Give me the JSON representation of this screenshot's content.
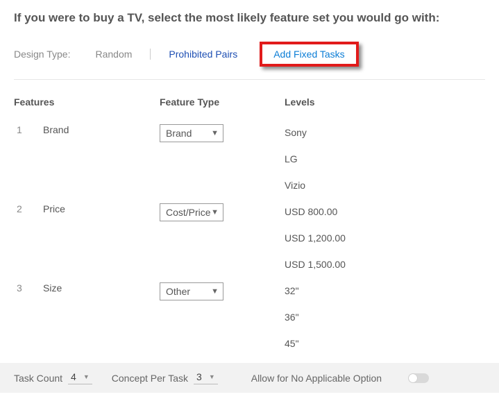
{
  "prompt": "If you were to buy a TV, select the most likely feature set you would go with:",
  "toolbar": {
    "design_type_label": "Design Type:",
    "design_type_value": "Random",
    "prohibited_pairs": "Prohibited Pairs",
    "add_fixed_tasks": "Add Fixed Tasks"
  },
  "headers": {
    "features": "Features",
    "feature_type": "Feature Type",
    "levels": "Levels"
  },
  "features": [
    {
      "idx": "1",
      "name": "Brand",
      "type": "Brand",
      "levels": [
        "Sony",
        "LG",
        "Vizio"
      ]
    },
    {
      "idx": "2",
      "name": "Price",
      "type": "Cost/Price",
      "levels": [
        "USD 800.00",
        "USD 1,200.00",
        "USD 1,500.00"
      ]
    },
    {
      "idx": "3",
      "name": "Size",
      "type": "Other",
      "levels": [
        "32\"",
        "36\"",
        "45\""
      ]
    }
  ],
  "footer": {
    "task_count_label": "Task Count",
    "task_count_value": "4",
    "concept_per_task_label": "Concept Per Task",
    "concept_per_task_value": "3",
    "allow_na_label": "Allow for No Applicable Option"
  }
}
